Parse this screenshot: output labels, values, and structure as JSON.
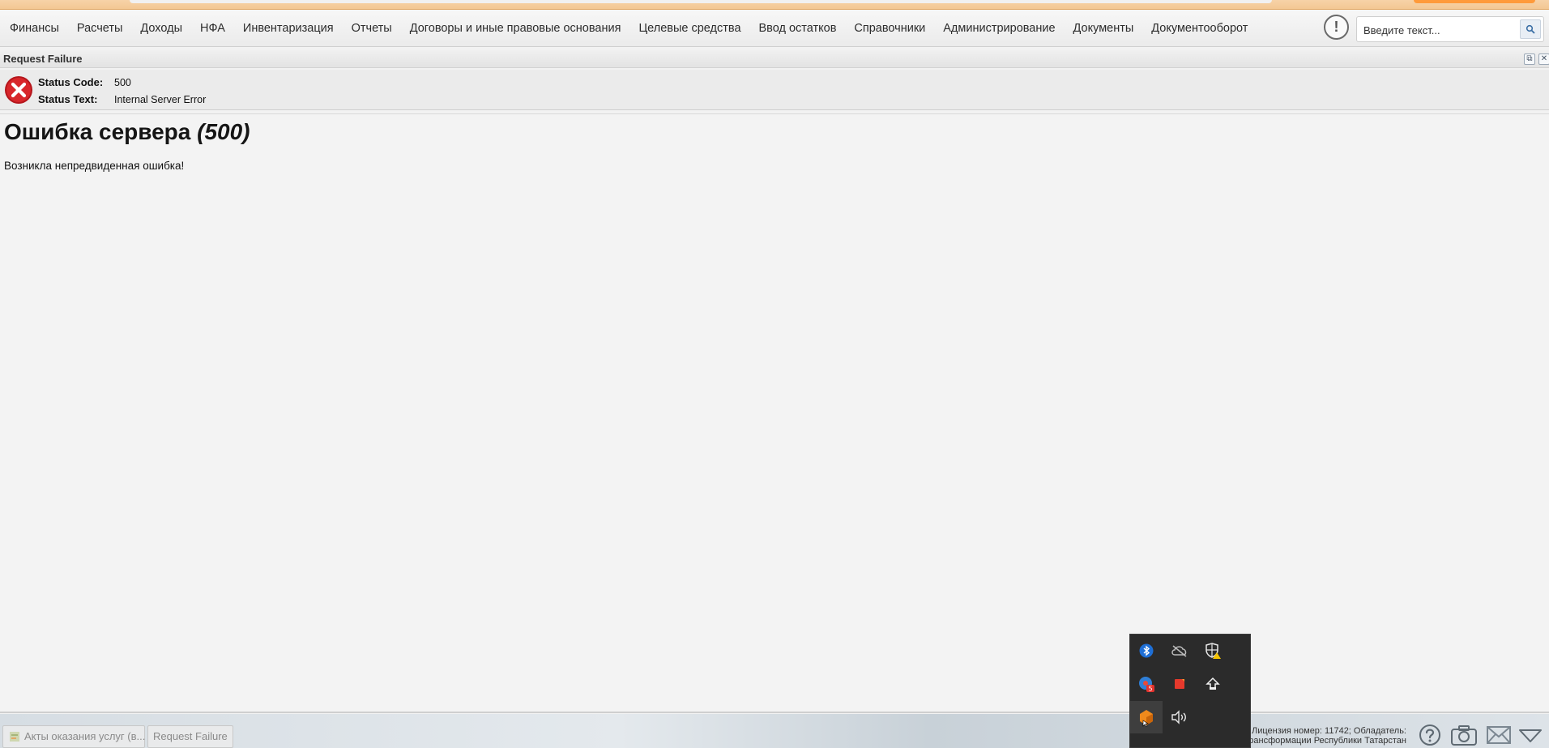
{
  "menu": {
    "items": [
      {
        "label": "Финансы"
      },
      {
        "label": "Расчеты"
      },
      {
        "label": "Доходы"
      },
      {
        "label": "НФА"
      },
      {
        "label": "Инвентаризация"
      },
      {
        "label": "Отчеты"
      },
      {
        "label": "Договоры и иные правовые основания"
      },
      {
        "label": "Целевые средства"
      },
      {
        "label": "Ввод остатков"
      },
      {
        "label": "Справочники"
      },
      {
        "label": "Администрирование"
      },
      {
        "label": "Документы"
      },
      {
        "label": "Документооборот"
      }
    ],
    "alert_glyph": "!"
  },
  "search": {
    "placeholder": "Введите текст..."
  },
  "window": {
    "title": "Request Failure",
    "restore_glyph": "⧉",
    "close_glyph": "✕"
  },
  "status": {
    "code_label": "Status Code:",
    "code_value": "500",
    "text_label": "Status Text:",
    "text_value": "Internal Server Error"
  },
  "content": {
    "heading": "Ошибка сервера",
    "heading_code": "(500)",
    "message": "Возникла непредвиденная ошибка!"
  },
  "taskbar": {
    "tasks": [
      {
        "label": "Акты оказания услуг (в..."
      },
      {
        "label": "Request Failure"
      }
    ],
    "license_line1": "Лицензия номер: 11742; Обладатель:",
    "license_line2": "рансформации Республики Татарстан"
  },
  "tray": {
    "icons": [
      "bluetooth-icon",
      "cloud-offline-icon",
      "shield-warning-icon",
      "browser-badge-icon",
      "red-app-icon",
      "eject-icon",
      "orange-app-icon",
      "speaker-icon"
    ],
    "badge_text": "5"
  },
  "colors": {
    "accent_orange": "#ff9a3a",
    "error_red": "#d8262a",
    "tray_bg": "#2b2b2b"
  }
}
